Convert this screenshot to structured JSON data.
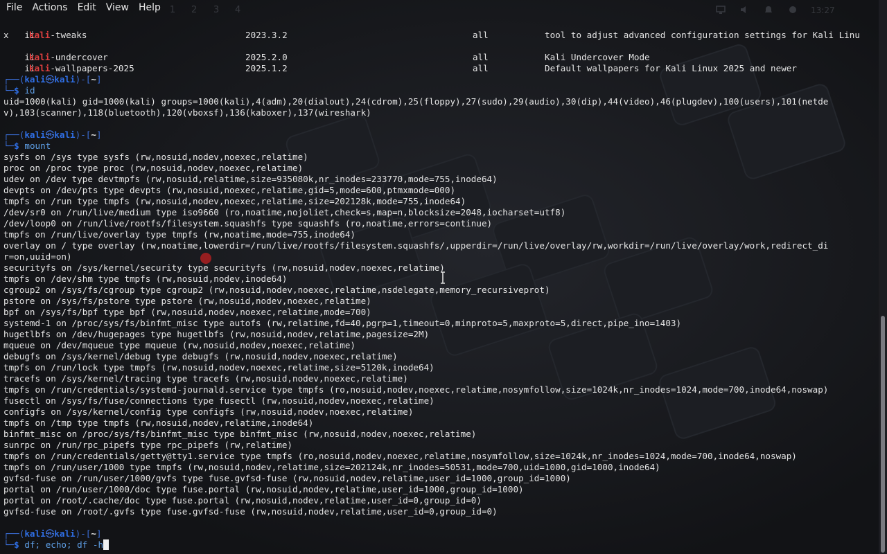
{
  "menu": [
    "File",
    "Actions",
    "Edit",
    "View",
    "Help"
  ],
  "tray": {
    "workspaces": [
      "1",
      "2",
      "3",
      "4"
    ],
    "clock": "13:27"
  },
  "packages": [
    {
      "status": "ii",
      "highlight": "kali",
      "rest": "-tweaks",
      "version": "2023.3.2",
      "arch": "all",
      "description": "tool to adjust advanced configuration settings for Kali Linu",
      "wrap": "x"
    },
    {
      "status": "ii",
      "highlight": "kali",
      "rest": "-undercover",
      "version": "2025.2.0",
      "arch": "all",
      "description": "Kali Undercover Mode"
    },
    {
      "status": "ii",
      "highlight": "kali",
      "rest": "-wallpapers-2025",
      "version": "2025.1.2",
      "arch": "all",
      "description": "Default wallpapers for Kali Linux 2025 and newer"
    }
  ],
  "prompt": {
    "user": "kali",
    "at": "㉿",
    "host": "kali",
    "dir": "~",
    "symbol": "$"
  },
  "commands": {
    "id": {
      "command": "id",
      "output": [
        "uid=1000(kali) gid=1000(kali) groups=1000(kali),4(adm),20(dialout),24(cdrom),25(floppy),27(sudo),29(audio),30(dip),44(video),46(plugdev),100(users),101(netde",
        "v),103(scanner),118(bluetooth),120(vboxsf),136(kaboxer),137(wireshark)"
      ]
    },
    "mount": {
      "command": "mount",
      "output": [
        "sysfs on /sys type sysfs (rw,nosuid,nodev,noexec,relatime)",
        "proc on /proc type proc (rw,nosuid,nodev,noexec,relatime)",
        "udev on /dev type devtmpfs (rw,nosuid,relatime,size=935080k,nr_inodes=233770,mode=755,inode64)",
        "devpts on /dev/pts type devpts (rw,nosuid,noexec,relatime,gid=5,mode=600,ptmxmode=000)",
        "tmpfs on /run type tmpfs (rw,nosuid,nodev,noexec,relatime,size=202128k,mode=755,inode64)",
        "/dev/sr0 on /run/live/medium type iso9660 (ro,noatime,nojoliet,check=s,map=n,blocksize=2048,iocharset=utf8)",
        "/dev/loop0 on /run/live/rootfs/filesystem.squashfs type squashfs (ro,noatime,errors=continue)",
        "tmpfs on /run/live/overlay type tmpfs (rw,noatime,mode=755,inode64)",
        "overlay on / type overlay (rw,noatime,lowerdir=/run/live/rootfs/filesystem.squashfs/,upperdir=/run/live/overlay/rw,workdir=/run/live/overlay/work,redirect_di",
        "r=on,uuid=on)",
        "securityfs on /sys/kernel/security type securityfs (rw,nosuid,nodev,noexec,relatime)",
        "tmpfs on /dev/shm type tmpfs (rw,nosuid,nodev,inode64)",
        "cgroup2 on /sys/fs/cgroup type cgroup2 (rw,nosuid,nodev,noexec,relatime,nsdelegate,memory_recursiveprot)",
        "pstore on /sys/fs/pstore type pstore (rw,nosuid,nodev,noexec,relatime)",
        "bpf on /sys/fs/bpf type bpf (rw,nosuid,nodev,noexec,relatime,mode=700)",
        "systemd-1 on /proc/sys/fs/binfmt_misc type autofs (rw,relatime,fd=40,pgrp=1,timeout=0,minproto=5,maxproto=5,direct,pipe_ino=1403)",
        "hugetlbfs on /dev/hugepages type hugetlbfs (rw,nosuid,nodev,relatime,pagesize=2M)",
        "mqueue on /dev/mqueue type mqueue (rw,nosuid,nodev,noexec,relatime)",
        "debugfs on /sys/kernel/debug type debugfs (rw,nosuid,nodev,noexec,relatime)",
        "tmpfs on /run/lock type tmpfs (rw,nosuid,nodev,noexec,relatime,size=5120k,inode64)",
        "tracefs on /sys/kernel/tracing type tracefs (rw,nosuid,nodev,noexec,relatime)",
        "tmpfs on /run/credentials/systemd-journald.service type tmpfs (ro,nosuid,nodev,noexec,relatime,nosymfollow,size=1024k,nr_inodes=1024,mode=700,inode64,noswap)",
        "fusectl on /sys/fs/fuse/connections type fusectl (rw,nosuid,nodev,noexec,relatime)",
        "configfs on /sys/kernel/config type configfs (rw,nosuid,nodev,noexec,relatime)",
        "tmpfs on /tmp type tmpfs (rw,nosuid,nodev,relatime,inode64)",
        "binfmt_misc on /proc/sys/fs/binfmt_misc type binfmt_misc (rw,nosuid,nodev,noexec,relatime)",
        "sunrpc on /run/rpc_pipefs type rpc_pipefs (rw,relatime)",
        "tmpfs on /run/credentials/getty@tty1.service type tmpfs (ro,nosuid,nodev,noexec,relatime,nosymfollow,size=1024k,nr_inodes=1024,mode=700,inode64,noswap)",
        "tmpfs on /run/user/1000 type tmpfs (rw,nosuid,nodev,relatime,size=202124k,nr_inodes=50531,mode=700,uid=1000,gid=1000,inode64)",
        "gvfsd-fuse on /run/user/1000/gvfs type fuse.gvfsd-fuse (rw,nosuid,nodev,relatime,user_id=1000,group_id=1000)",
        "portal on /run/user/1000/doc type fuse.portal (rw,nosuid,nodev,relatime,user_id=1000,group_id=1000)",
        "portal on /root/.cache/doc type fuse.portal (rw,nosuid,nodev,relatime,user_id=0,group_id=0)",
        "gvfsd-fuse on /root/.gvfs type fuse.gvfsd-fuse (rw,nosuid,nodev,relatime,user_id=0,group_id=0)"
      ]
    }
  },
  "current_input": "df; echo; df -h",
  "scroll_fraction": {
    "start": 0.57,
    "end": 1.0
  },
  "colors": {
    "background": "#141518",
    "text": "#e5e5e5",
    "kali_highlight": "#e04040",
    "prompt_frame": "#3b6fd9",
    "command": "#5fa0e8"
  }
}
